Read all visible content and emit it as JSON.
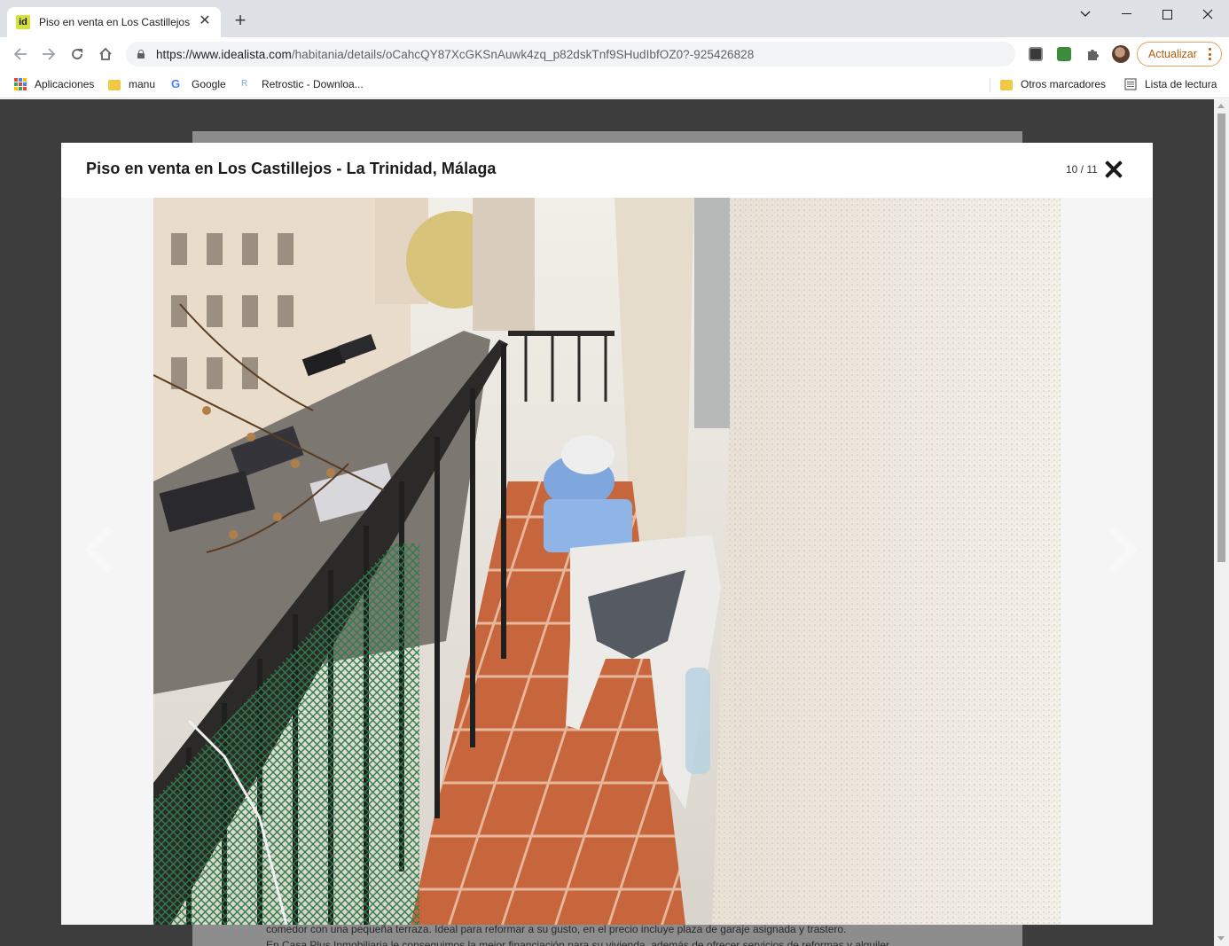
{
  "tab": {
    "title": "Piso en venta en Los Castillejos -",
    "favicon": "id"
  },
  "toolbar": {
    "url_host": "https://www.idealista.com",
    "url_path": "/habitania/details/oCahcQY87XcGKSnAuwk4zq_p82dskTnf9SHudIbfOZ0?-925426828",
    "update_label": "Actualizar"
  },
  "bookmarks": {
    "items": [
      {
        "label": "Aplicaciones",
        "icon": "apps-grid-icon"
      },
      {
        "label": "manu",
        "icon": "folder-icon"
      },
      {
        "label": "Google",
        "icon": "google-icon"
      },
      {
        "label": "Retrostic - Downloa...",
        "icon": "retrostic-icon"
      }
    ],
    "other": "Otros marcadores",
    "reading_list": "Lista de lectura"
  },
  "modal": {
    "title": "Piso en venta en Los Castillejos - La Trinidad, Málaga",
    "counter": "10 / 11"
  },
  "page": {
    "text_line1": "comedor con una pequeña terraza. Ideal para reformar a su gusto, en el precio incluye plaza de garaje asignada y trastero.",
    "text_line2": "En Casa Plus Inmobiliaria le conseguimos la mejor financiación para su vivienda, además de ofrecer servicios de reformas y alquiler."
  },
  "colors": {
    "accent_update": "#b25d07",
    "idealista_brand": "#d4e23b",
    "overlay": "#3d3d3d"
  }
}
